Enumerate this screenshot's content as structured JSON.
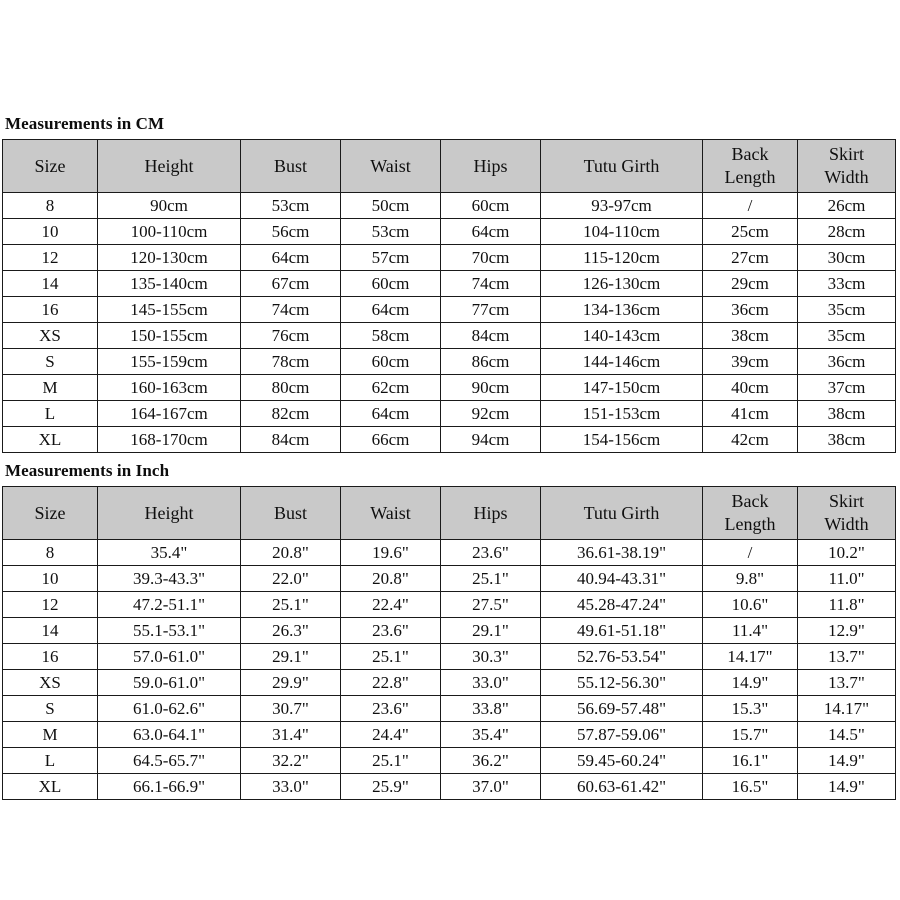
{
  "document": {
    "type": "size-chart",
    "background_color": "#ffffff",
    "header_fill": "#c9c9c9",
    "border_color": "#1a1a1a",
    "text_color": "#0f0f0f"
  },
  "sections": [
    {
      "id": "cm",
      "title": "Measurements in CM",
      "columns": [
        {
          "key": "size",
          "lines": [
            "Size"
          ]
        },
        {
          "key": "height",
          "lines": [
            "Height"
          ]
        },
        {
          "key": "bust",
          "lines": [
            "Bust"
          ]
        },
        {
          "key": "waist",
          "lines": [
            "Waist"
          ]
        },
        {
          "key": "hips",
          "lines": [
            "Hips"
          ]
        },
        {
          "key": "tutu_girth",
          "lines": [
            "Tutu Girth"
          ]
        },
        {
          "key": "back_length",
          "lines": [
            "Back",
            "Length"
          ]
        },
        {
          "key": "skirt_width",
          "lines": [
            "Skirt",
            "Width"
          ]
        }
      ],
      "rows": [
        [
          "8",
          "90cm",
          "53cm",
          "50cm",
          "60cm",
          "93-97cm",
          "/",
          "26cm"
        ],
        [
          "10",
          "100-110cm",
          "56cm",
          "53cm",
          "64cm",
          "104-110cm",
          "25cm",
          "28cm"
        ],
        [
          "12",
          "120-130cm",
          "64cm",
          "57cm",
          "70cm",
          "115-120cm",
          "27cm",
          "30cm"
        ],
        [
          "14",
          "135-140cm",
          "67cm",
          "60cm",
          "74cm",
          "126-130cm",
          "29cm",
          "33cm"
        ],
        [
          "16",
          "145-155cm",
          "74cm",
          "64cm",
          "77cm",
          "134-136cm",
          "36cm",
          "35cm"
        ],
        [
          "XS",
          "150-155cm",
          "76cm",
          "58cm",
          "84cm",
          "140-143cm",
          "38cm",
          "35cm"
        ],
        [
          "S",
          "155-159cm",
          "78cm",
          "60cm",
          "86cm",
          "144-146cm",
          "39cm",
          "36cm"
        ],
        [
          "M",
          "160-163cm",
          "80cm",
          "62cm",
          "90cm",
          "147-150cm",
          "40cm",
          "37cm"
        ],
        [
          "L",
          "164-167cm",
          "82cm",
          "64cm",
          "92cm",
          "151-153cm",
          "41cm",
          "38cm"
        ],
        [
          "XL",
          "168-170cm",
          "84cm",
          "66cm",
          "94cm",
          "154-156cm",
          "42cm",
          "38cm"
        ]
      ]
    },
    {
      "id": "inch",
      "title": "Measurements in Inch",
      "columns": [
        {
          "key": "size",
          "lines": [
            "Size"
          ]
        },
        {
          "key": "height",
          "lines": [
            "Height"
          ]
        },
        {
          "key": "bust",
          "lines": [
            "Bust"
          ]
        },
        {
          "key": "waist",
          "lines": [
            "Waist"
          ]
        },
        {
          "key": "hips",
          "lines": [
            "Hips"
          ]
        },
        {
          "key": "tutu_girth",
          "lines": [
            "Tutu Girth"
          ]
        },
        {
          "key": "back_length",
          "lines": [
            "Back",
            "Length"
          ]
        },
        {
          "key": "skirt_width",
          "lines": [
            "Skirt",
            "Width"
          ]
        }
      ],
      "rows": [
        [
          "8",
          "35.4\"",
          "20.8\"",
          "19.6\"",
          "23.6\"",
          "36.61-38.19\"",
          "/",
          "10.2\""
        ],
        [
          "10",
          "39.3-43.3\"",
          "22.0\"",
          "20.8\"",
          "25.1\"",
          "40.94-43.31\"",
          "9.8\"",
          "11.0\""
        ],
        [
          "12",
          "47.2-51.1\"",
          "25.1\"",
          "22.4\"",
          "27.5\"",
          "45.28-47.24\"",
          "10.6\"",
          "11.8\""
        ],
        [
          "14",
          "55.1-53.1\"",
          "26.3\"",
          "23.6\"",
          "29.1\"",
          "49.61-51.18\"",
          "11.4\"",
          "12.9\""
        ],
        [
          "16",
          "57.0-61.0\"",
          "29.1\"",
          "25.1\"",
          "30.3\"",
          "52.76-53.54\"",
          "14.17\"",
          "13.7\""
        ],
        [
          "XS",
          "59.0-61.0\"",
          "29.9\"",
          "22.8\"",
          "33.0\"",
          "55.12-56.30\"",
          "14.9\"",
          "13.7\""
        ],
        [
          "S",
          "61.0-62.6\"",
          "30.7\"",
          "23.6\"",
          "33.8\"",
          "56.69-57.48\"",
          "15.3\"",
          "14.17\""
        ],
        [
          "M",
          "63.0-64.1\"",
          "31.4\"",
          "24.4\"",
          "35.4\"",
          "57.87-59.06\"",
          "15.7\"",
          "14.5\""
        ],
        [
          "L",
          "64.5-65.7\"",
          "32.2\"",
          "25.1\"",
          "36.2\"",
          "59.45-60.24\"",
          "16.1\"",
          "14.9\""
        ],
        [
          "XL",
          "66.1-66.9\"",
          "33.0\"",
          "25.9\"",
          "37.0\"",
          "60.63-61.42\"",
          "16.5\"",
          "14.9\""
        ]
      ]
    }
  ]
}
